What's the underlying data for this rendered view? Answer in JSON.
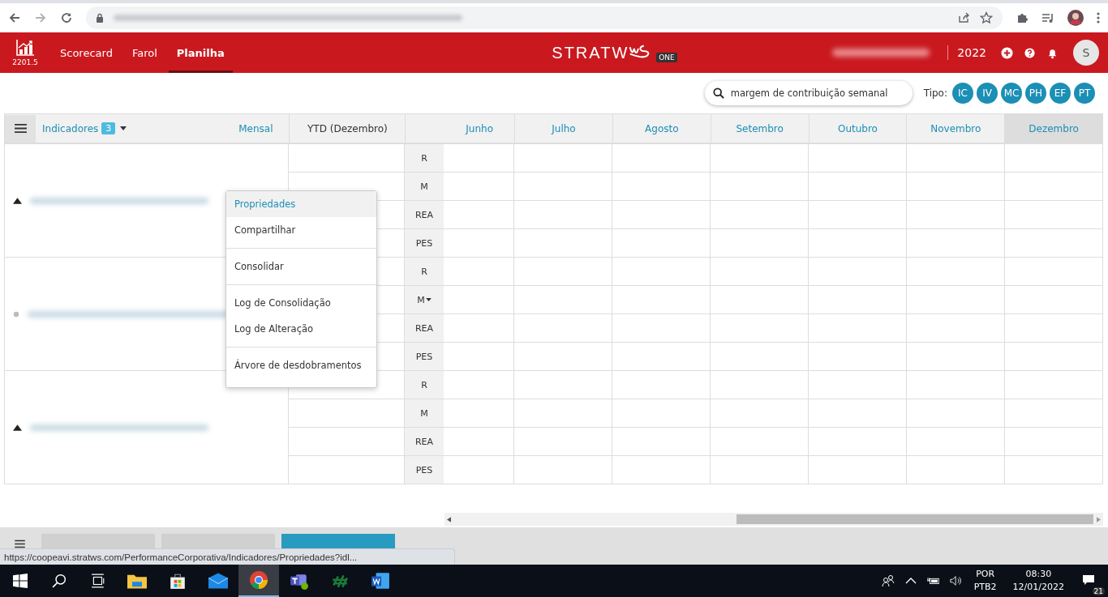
{
  "header": {
    "version": "2201.5",
    "nav": [
      {
        "label": "Scorecard",
        "selected": false
      },
      {
        "label": "Farol",
        "selected": false
      },
      {
        "label": "Planilha",
        "selected": true
      }
    ],
    "logo": {
      "text": "STRATW",
      "badge": "ONE"
    },
    "year": "2022",
    "avatar": "S"
  },
  "toolbar": {
    "search": {
      "value": "margem de contribuição semanal"
    },
    "tipo_label": "Tipo:",
    "types": [
      "IC",
      "IV",
      "MC",
      "PH",
      "EF",
      "PT"
    ]
  },
  "table": {
    "indicators_label": "Indicadores",
    "indicators_count": "3",
    "period": "Mensal",
    "ytd": "YTD (Dezembro)",
    "months": [
      {
        "label": "Junho",
        "selected": false
      },
      {
        "label": "Julho",
        "selected": false
      },
      {
        "label": "Agosto",
        "selected": false
      },
      {
        "label": "Setembro",
        "selected": false
      },
      {
        "label": "Outubro",
        "selected": false
      },
      {
        "label": "Novembro",
        "selected": false
      },
      {
        "label": "Dezembro",
        "selected": true
      }
    ],
    "groups": [
      {
        "expanded": true,
        "rows": [
          {
            "label": "R",
            "dropdown": false
          },
          {
            "label": "M",
            "dropdown": false
          },
          {
            "label": "REA",
            "dropdown": false
          },
          {
            "label": "PES",
            "dropdown": false
          }
        ]
      },
      {
        "expanded": false,
        "rows": [
          {
            "label": "R",
            "dropdown": false
          },
          {
            "label": "M",
            "dropdown": true
          },
          {
            "label": "REA",
            "dropdown": false
          },
          {
            "label": "PES",
            "dropdown": false
          }
        ]
      },
      {
        "expanded": true,
        "rows": [
          {
            "label": "R",
            "dropdown": false
          },
          {
            "label": "M",
            "dropdown": false
          },
          {
            "label": "REA",
            "dropdown": false
          },
          {
            "label": "PES",
            "dropdown": false
          }
        ]
      }
    ]
  },
  "context_menu": {
    "sections": [
      [
        {
          "label": "Propriedades",
          "selected": true
        },
        {
          "label": "Compartilhar",
          "selected": false
        }
      ],
      [
        {
          "label": "Consolidar",
          "selected": false
        }
      ],
      [
        {
          "label": "Log de Consolidação",
          "selected": false
        },
        {
          "label": "Log de Alteração",
          "selected": false
        }
      ],
      [
        {
          "label": "Árvore de desdobramentos",
          "selected": false
        }
      ]
    ]
  },
  "bottom_tabs": [
    {
      "selected": false
    },
    {
      "selected": false
    },
    {
      "selected": true
    }
  ],
  "status_url": "https://coopeavi.stratws.com/PerformanceCorporativa/Indicadores/Propriedades?idl...",
  "taskbar": {
    "language": [
      "POR",
      "PTB2"
    ],
    "time": "08:30",
    "date": "12/01/2022",
    "notifications": "21"
  }
}
